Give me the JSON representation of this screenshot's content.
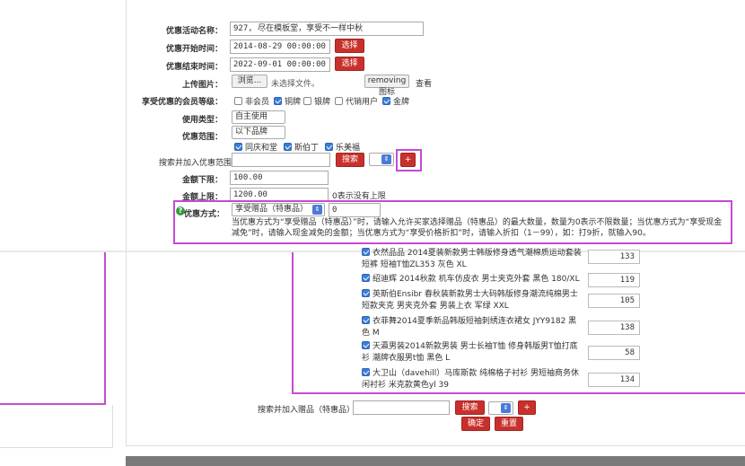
{
  "form": {
    "name_label": "优惠活动名称：",
    "name_value": "927, 尽在模板堂，享受不一样中秋",
    "start_label": "优惠开始时间：",
    "start_value": "2014-08-29 00:00:00",
    "end_label": "优惠结束时间：",
    "end_value": "2022-09-01 00:00:00",
    "select_label": "选择",
    "upload_label": "上传图片：",
    "browse_label": "浏览...",
    "no_file_text": "未选择文件。",
    "remove_icon_label": "removing图标",
    "view_label": "查看",
    "member_label": "享受优惠的会员等级：",
    "members": [
      {
        "label": "非会员",
        "checked": false
      },
      {
        "label": "铜牌",
        "checked": true
      },
      {
        "label": "银牌",
        "checked": false
      },
      {
        "label": "代销用户",
        "checked": false
      },
      {
        "label": "金牌",
        "checked": true
      }
    ],
    "usage_label": "使用类型：",
    "usage_value": "自主使用",
    "scope_label": "优惠范围：",
    "scope_value": "以下品牌",
    "brands": [
      {
        "label": "同庆和堂",
        "checked": true
      },
      {
        "label": "斯伯丁",
        "checked": true
      },
      {
        "label": "乐美福",
        "checked": true
      }
    ],
    "search_scope_label": "搜索并加入优惠范围",
    "search_label": "搜索",
    "plus_label": "+",
    "min_amount_label": "金额下限：",
    "min_amount_value": "100.00",
    "max_amount_label": "金额上限：",
    "max_amount_value": "1200.00",
    "max_amount_hint": "0表示没有上限",
    "mode_label": "优惠方式：",
    "mode_value": "享受赠品（特惠品）",
    "mode_number": "0",
    "mode_help": "当优惠方式为“享受赠品（特惠品）”时，请输入允许买家选择赠品（特惠品）的最大数量，数量为0表示不限数量；当优惠方式为“享受现金减免”时，请输入现金减免的金额；当优惠方式为“享受价格折扣”时，请输入折扣（1－99），如：打9折，就输入90。",
    "products": [
      {
        "name": "衣然品品 2014夏装新款男士韩版修身透气潮棉质运动套装短裤 短袖T恤ZL353 灰色 XL",
        "qty": "133"
      },
      {
        "name": "绍迪辉 2014秋款 机车仿皮衣 男士夹克外套 黑色 180/XL",
        "qty": "119"
      },
      {
        "name": "英斯伯Ensibr 春秋装新款男士大码韩版修身潮流纯棉男士短款夹克 男夹克外套 男装上衣 军绿 XXL",
        "qty": "105"
      },
      {
        "name": "衣菲舞2014夏季新品韩版短袖刺绣连衣裙女 JYY9182 黑色 M",
        "qty": "138"
      },
      {
        "name": "天瀛男装2014新款男装 男士长袖T恤 修身韩版男T恤打底衫 潮牌衣服男t恤 黑色 L",
        "qty": "58"
      },
      {
        "name": "大卫山（davehill）马库斯款 纯棉格子衬衫 男短袖商务休闲衬衫 米克款黄色yl 39",
        "qty": "134"
      }
    ],
    "gift_search_label": "搜索并加入赠品（特惠品）",
    "confirm_label": "确定",
    "reset_label": "重置"
  }
}
